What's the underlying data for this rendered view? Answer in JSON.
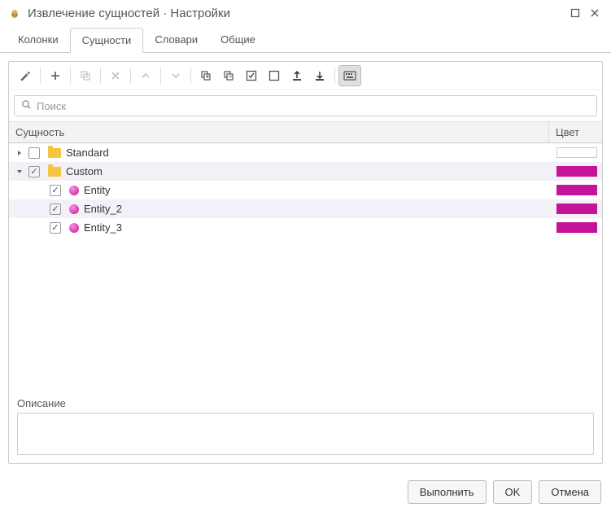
{
  "window": {
    "title": "Извлечение сущностей · Настройки"
  },
  "tabs": {
    "items": [
      "Колонки",
      "Сущности",
      "Словари",
      "Общие"
    ],
    "active": 1
  },
  "search": {
    "placeholder": "Поиск"
  },
  "columns": {
    "entity": "Сущность",
    "color": "Цвет"
  },
  "tree": {
    "items": [
      {
        "label": "Standard",
        "type": "folder",
        "expanded": false,
        "checked": false,
        "level": 0,
        "alt": false,
        "color": ""
      },
      {
        "label": "Custom",
        "type": "folder",
        "expanded": true,
        "checked": true,
        "level": 0,
        "alt": true,
        "color": "#c4139a"
      },
      {
        "label": "Entity",
        "type": "entity",
        "checked": true,
        "level": 1,
        "alt": false,
        "color": "#c4139a"
      },
      {
        "label": "Entity_2",
        "type": "entity",
        "checked": true,
        "level": 1,
        "alt": true,
        "color": "#c4139a"
      },
      {
        "label": "Entity_3",
        "type": "entity",
        "checked": true,
        "level": 1,
        "alt": false,
        "color": "#c4139a"
      }
    ]
  },
  "description": {
    "label": "Описание"
  },
  "buttons": {
    "run": "Выполнить",
    "ok": "OK",
    "cancel": "Отмена"
  }
}
